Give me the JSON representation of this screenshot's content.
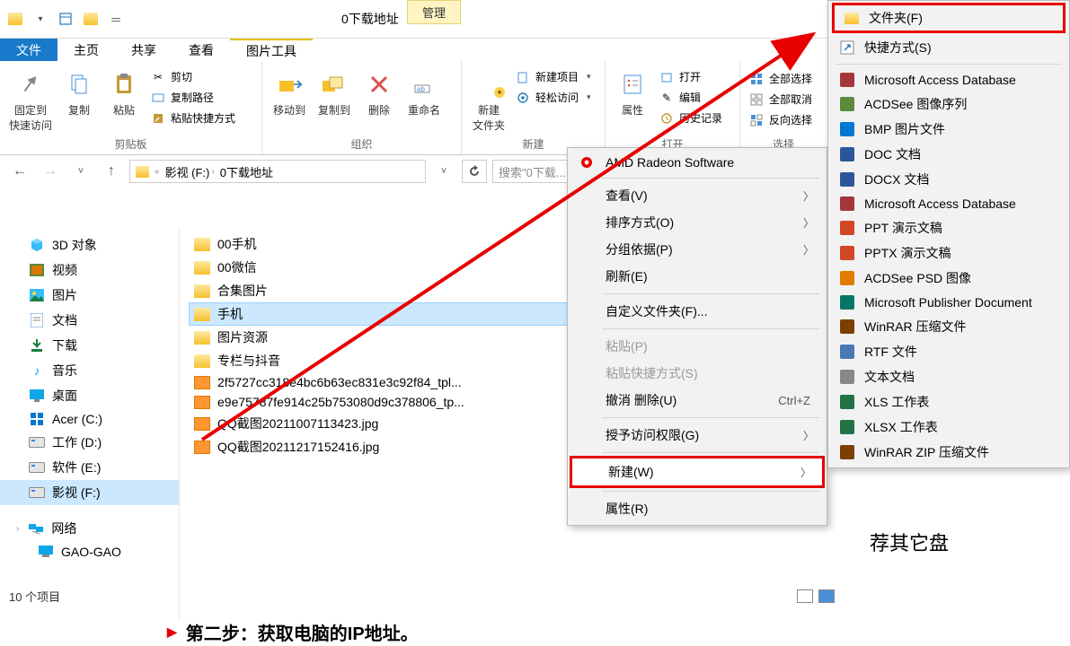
{
  "title": "0下载地址",
  "tabs": {
    "file": "文件",
    "home": "主页",
    "share": "共享",
    "view": "查看",
    "pic_tools_header": "管理",
    "pic_tools": "图片工具"
  },
  "ribbon": {
    "pin": "固定到\n快速访问",
    "copy": "复制",
    "paste": "粘贴",
    "cut": "剪切",
    "copy_path": "复制路径",
    "paste_shortcut": "粘贴快捷方式",
    "clipboard_group": "剪贴板",
    "move_to": "移动到",
    "copy_to": "复制到",
    "delete": "删除",
    "rename": "重命名",
    "organize_group": "组织",
    "new_folder": "新建\n文件夹",
    "new_item": "新建项目",
    "easy_access": "轻松访问",
    "new_group": "新建",
    "properties": "属性",
    "open": "打开",
    "edit": "编辑",
    "history": "历史记录",
    "open_group": "打开",
    "select_all": "全部选择",
    "select_none": "全部取消",
    "invert": "反向选择",
    "select_group": "选择"
  },
  "address": {
    "seg1": "影视 (F:)",
    "seg2": "0下载地址"
  },
  "search_placeholder": "搜索\"0下载...",
  "tree": {
    "obj3d": "3D 对象",
    "video": "视频",
    "pictures": "图片",
    "documents": "文档",
    "downloads": "下载",
    "music": "音乐",
    "desktop": "桌面",
    "acer": "Acer (C:)",
    "work": "工作 (D:)",
    "soft": "软件 (E:)",
    "video_drive": "影视 (F:)",
    "network": "网络",
    "gao": "GAO-GAO"
  },
  "files": [
    {
      "name": "00手机",
      "type": "folder"
    },
    {
      "name": "00微信",
      "type": "folder"
    },
    {
      "name": "合集图片",
      "type": "folder"
    },
    {
      "name": "手机",
      "type": "folder",
      "selected": true
    },
    {
      "name": "图片资源",
      "type": "folder"
    },
    {
      "name": "专栏与抖音",
      "type": "folder"
    },
    {
      "name": "2f5727cc318e4bc6b63ec831e3c92f84_tpl...",
      "type": "image"
    },
    {
      "name": "e9e75787fe914c25b753080d9c378806_tp...",
      "type": "image"
    },
    {
      "name": "QQ截图20211007113423.jpg",
      "type": "image"
    },
    {
      "name": "QQ截图20211217152416.jpg",
      "type": "image"
    }
  ],
  "status": "10 个项目",
  "context_menu": {
    "amd": "AMD Radeon Software",
    "view": "查看(V)",
    "sort": "排序方式(O)",
    "group": "分组依据(P)",
    "refresh": "刷新(E)",
    "customize": "自定义文件夹(F)...",
    "paste": "粘贴(P)",
    "paste_shortcut": "粘贴快捷方式(S)",
    "undo": "撤消 删除(U)",
    "undo_key": "Ctrl+Z",
    "grant": "授予访问权限(G)",
    "new": "新建(W)",
    "props": "属性(R)"
  },
  "new_submenu": [
    {
      "label": "文件夹(F)",
      "icon": "folder",
      "highlight": true
    },
    {
      "label": "快捷方式(S)",
      "icon": "shortcut"
    },
    {
      "sep": true
    },
    {
      "label": "Microsoft Access Database",
      "icon": "access",
      "color": "#A4373A"
    },
    {
      "label": "ACDSee 图像序列",
      "icon": "acd",
      "color": "#5B8A3C"
    },
    {
      "label": "BMP 图片文件",
      "icon": "bmp",
      "color": "#0078D4"
    },
    {
      "label": "DOC 文档",
      "icon": "doc",
      "color": "#2B579A"
    },
    {
      "label": "DOCX 文档",
      "icon": "docx",
      "color": "#2B579A"
    },
    {
      "label": "Microsoft Access Database",
      "icon": "access2",
      "color": "#A4373A"
    },
    {
      "label": "PPT 演示文稿",
      "icon": "ppt",
      "color": "#D24726"
    },
    {
      "label": "PPTX 演示文稿",
      "icon": "pptx",
      "color": "#D24726"
    },
    {
      "label": "ACDSee PSD 图像",
      "icon": "psd",
      "color": "#E07B00"
    },
    {
      "label": "Microsoft Publisher Document",
      "icon": "pub",
      "color": "#077568"
    },
    {
      "label": "WinRAR 压缩文件",
      "icon": "rar",
      "color": "#7B3F00"
    },
    {
      "label": "RTF 文件",
      "icon": "rtf",
      "color": "#4A78B5"
    },
    {
      "label": "文本文档",
      "icon": "txt",
      "color": "#888"
    },
    {
      "label": "XLS 工作表",
      "icon": "xls",
      "color": "#217346"
    },
    {
      "label": "XLSX 工作表",
      "icon": "xlsx",
      "color": "#217346"
    },
    {
      "label": "WinRAR ZIP 压缩文件",
      "icon": "zip",
      "color": "#7B3F00"
    }
  ],
  "partial_right": "荐其它盘",
  "step2": "第二步：获取电脑的IP地址。"
}
